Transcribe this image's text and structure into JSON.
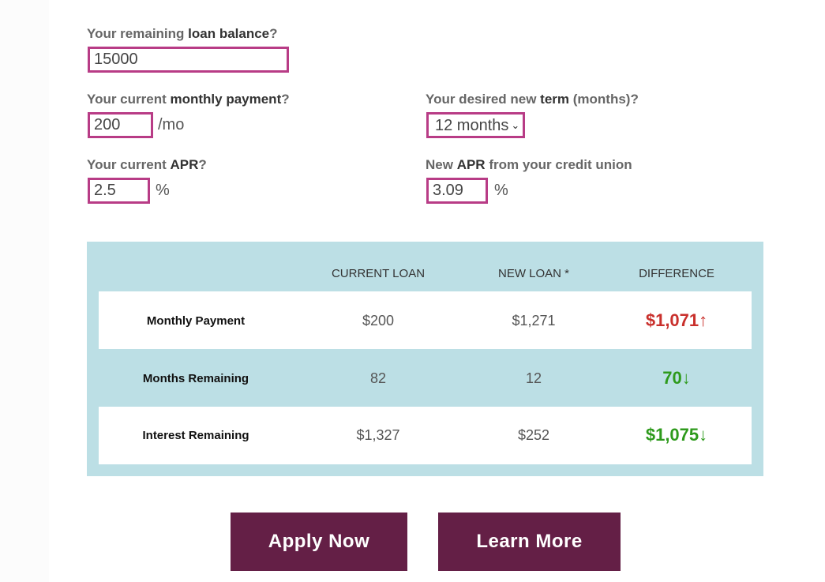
{
  "form": {
    "balance": {
      "label_pre": "Your remaining ",
      "label_bold": "loan balance",
      "label_post": "?",
      "value": "15000"
    },
    "payment": {
      "label_pre": "Your current ",
      "label_bold": "monthly payment",
      "label_post": "?",
      "value": "200",
      "unit": "/mo"
    },
    "term": {
      "label_pre": "Your desired new ",
      "label_bold": "term",
      "label_post": " (months)?",
      "selected": "12 months"
    },
    "apr": {
      "label_pre": "Your current ",
      "label_bold": "APR",
      "label_post": "?",
      "value": "2.5",
      "unit": "%"
    },
    "new_apr": {
      "label_pre": "New ",
      "label_bold": "APR",
      "label_post": " from your credit union",
      "value": "3.09",
      "unit": "%"
    }
  },
  "results": {
    "headers": [
      "CURRENT LOAN",
      "NEW LOAN *",
      "DIFFERENCE"
    ],
    "rows": [
      {
        "label": "Monthly Payment",
        "current": "$200",
        "new": "$1,271",
        "difference": "$1,071",
        "arrow": "↑",
        "color": "#c9302c"
      },
      {
        "label": "Months Remaining",
        "current": "82",
        "new": "12",
        "difference": "70",
        "arrow": "↓",
        "color": "#2e9a1c"
      },
      {
        "label": "Interest Remaining",
        "current": "$1,327",
        "new": "$252",
        "difference": "$1,075",
        "arrow": "↓",
        "color": "#2e9a1c"
      }
    ]
  },
  "buttons": {
    "apply": "Apply Now",
    "learn": "Learn More"
  },
  "colors": {
    "accent_border": "#b83c86",
    "button_bg": "#641f46",
    "table_bg": "#bcdfe5"
  }
}
